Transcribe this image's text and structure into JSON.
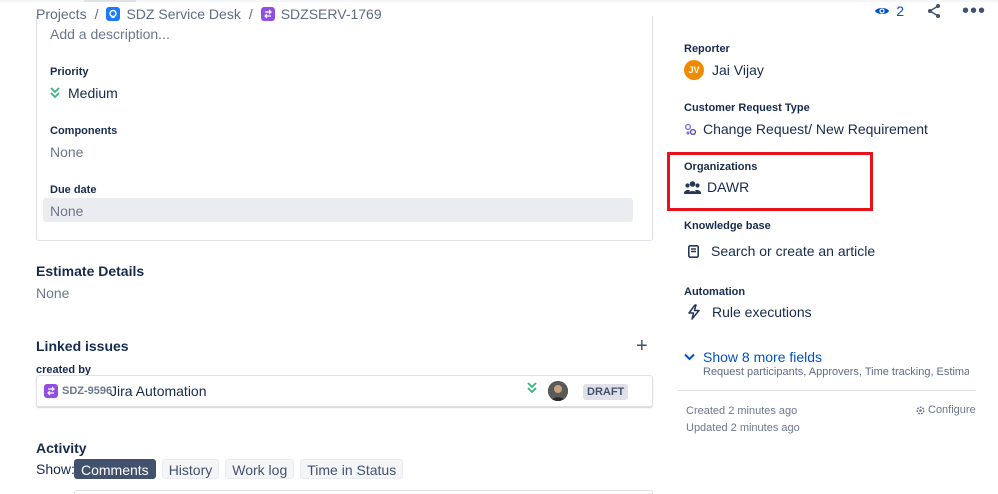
{
  "breadcrumb": {
    "projects": "Projects",
    "separator": "/",
    "project": "SDZ Service Desk",
    "issue_key": "SDZSERV-1769"
  },
  "header": {
    "watchers_count": "2"
  },
  "details": {
    "description_placeholder": "Add a description...",
    "priority_label": "Priority",
    "priority_value": "Medium",
    "components_label": "Components",
    "components_value": "None",
    "due_date_label": "Due date",
    "due_date_value": "None"
  },
  "estimate": {
    "title": "Estimate Details",
    "value": "None"
  },
  "linked_issues": {
    "title": "Linked issues",
    "relation": "created by",
    "items": [
      {
        "key": "SDZ-9596",
        "summary": "Jira Automation",
        "status": "DRAFT"
      }
    ]
  },
  "activity": {
    "title": "Activity",
    "show_label": "Show:",
    "tabs": [
      "Comments",
      "History",
      "Work log",
      "Time in Status"
    ],
    "active_tab": "Comments"
  },
  "sidebar": {
    "reporter_label": "Reporter",
    "reporter_initials": "JV",
    "reporter_name": "Jai Vijay",
    "request_type_label": "Customer Request Type",
    "request_type_value": "Change Request/ New Requirement",
    "organizations_label": "Organizations",
    "organizations_value": "DAWR",
    "knowledge_label": "Knowledge base",
    "knowledge_value": "Search or create an article",
    "automation_label": "Automation",
    "automation_value": "Rule executions",
    "show_more": "Show 8 more fields",
    "show_more_sub": "Request participants, Approvers, Time tracking, Estimates, R...",
    "created": "Created 2 minutes ago",
    "updated": "Updated 2 minutes ago",
    "configure": "Configure"
  },
  "colors": {
    "link": "#0052cc",
    "highlight": "#e8131a",
    "priority_medium": "#36b37e",
    "reporter_avatar": "#f08a00"
  }
}
